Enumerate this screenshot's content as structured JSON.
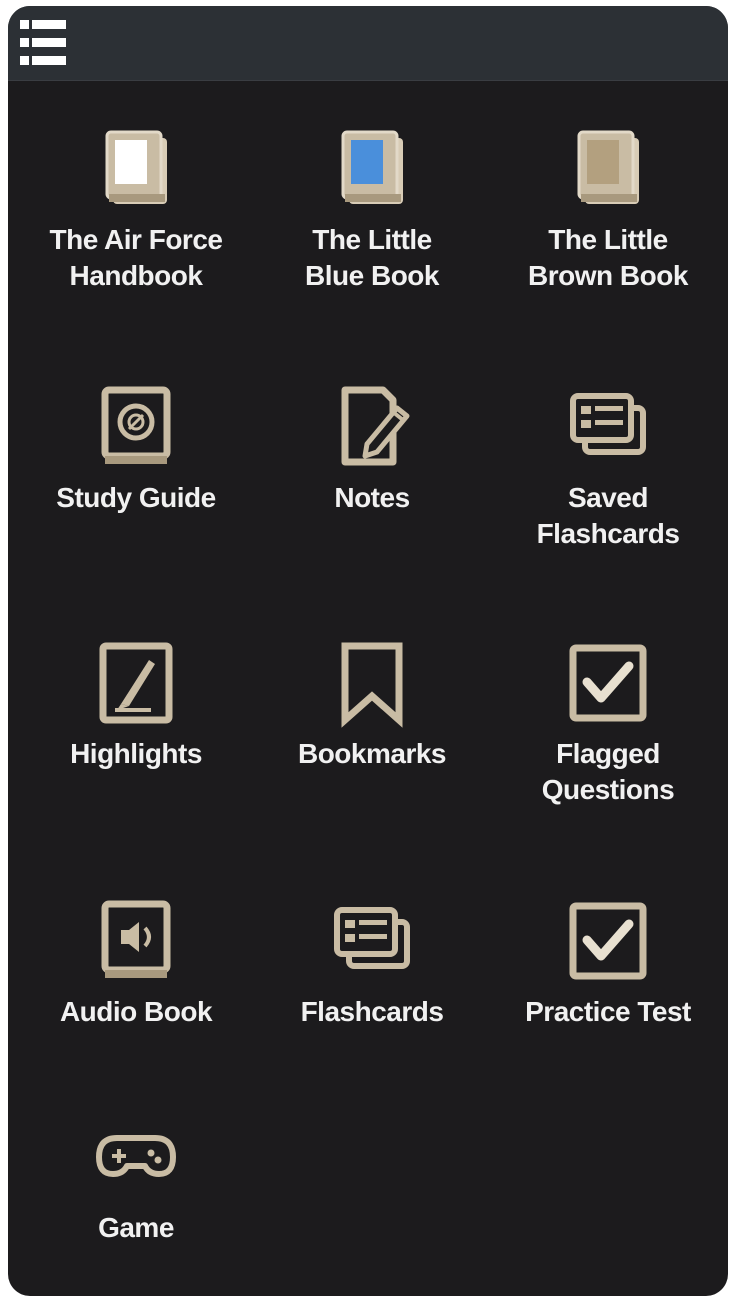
{
  "header": {
    "menu_icon": "hamburger-menu-icon"
  },
  "colors": {
    "background": "#1c1b1d",
    "topbar": "#2c3035",
    "icon_beige": "#c9bca4",
    "icon_outline": "#e2d9c8",
    "blue_book": "#4a8fdb",
    "brown_book": "#b3a07f",
    "label": "#f1f1f1"
  },
  "items": [
    {
      "label": "The Air Force\nHandbook",
      "icon": "white-book-icon"
    },
    {
      "label": "The Little\nBlue Book",
      "icon": "blue-book-icon"
    },
    {
      "label": "The Little\nBrown Book",
      "icon": "brown-book-icon"
    },
    {
      "label": "Study Guide",
      "icon": "study-guide-icon"
    },
    {
      "label": "Notes",
      "icon": "notes-icon"
    },
    {
      "label": "Saved\nFlashcards",
      "icon": "saved-flashcards-icon"
    },
    {
      "label": "Highlights",
      "icon": "highlights-icon"
    },
    {
      "label": "Bookmarks",
      "icon": "bookmark-icon"
    },
    {
      "label": "Flagged\nQuestions",
      "icon": "flagged-questions-icon"
    },
    {
      "label": "Audio Book",
      "icon": "audio-book-icon"
    },
    {
      "label": "Flashcards",
      "icon": "flashcards-icon"
    },
    {
      "label": "Practice Test",
      "icon": "practice-test-icon"
    },
    {
      "label": "Game",
      "icon": "game-controller-icon"
    }
  ]
}
